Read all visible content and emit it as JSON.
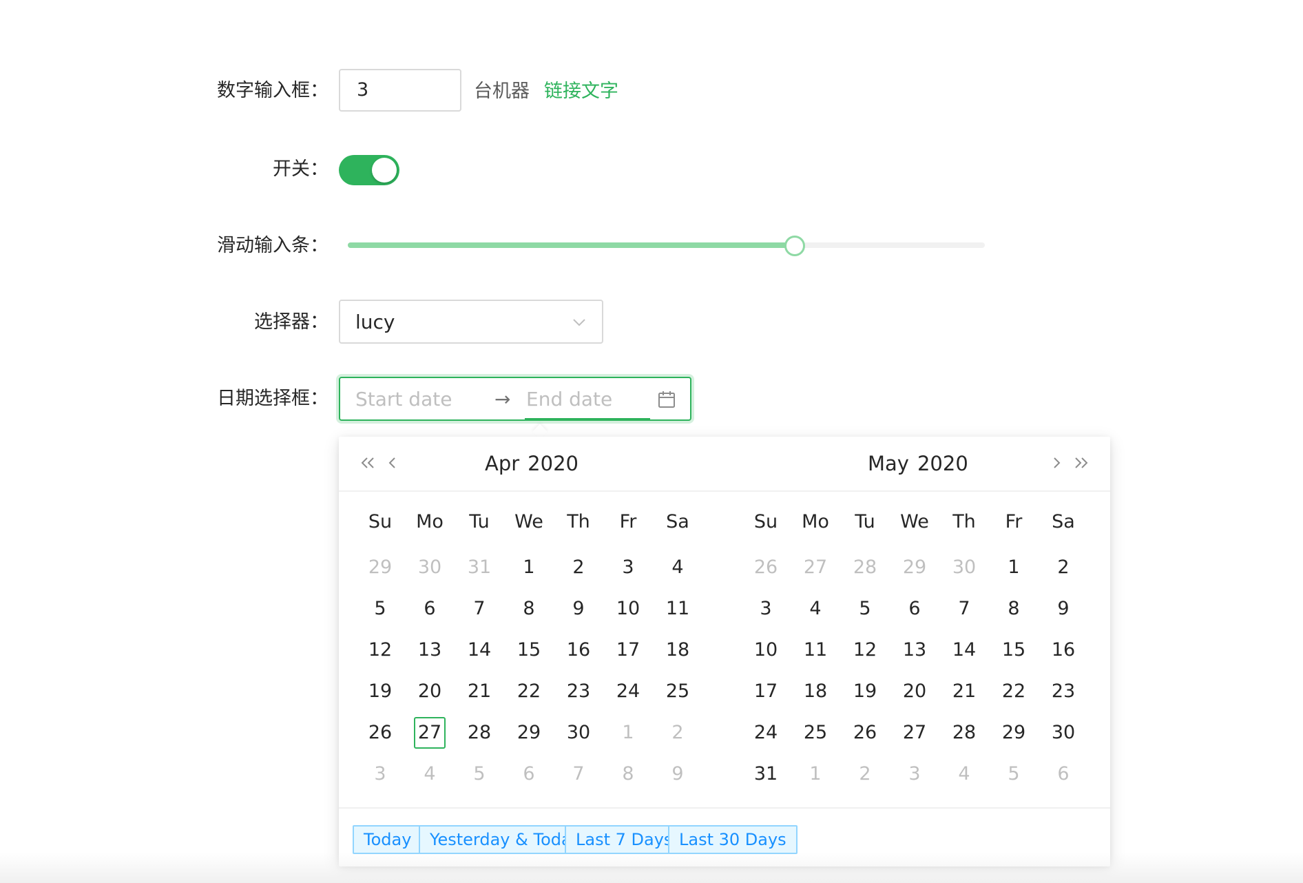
{
  "form": {
    "number_label": "数字输入框：",
    "number_value": "3",
    "number_unit": "台机器",
    "link_text": "链接文字",
    "switch_label": "开关：",
    "switch_on": true,
    "slider_label": "滑动输入条：",
    "slider_value_percent": 70,
    "select_label": "选择器：",
    "select_value": "lucy",
    "date_label": "日期选择框：",
    "date_start_placeholder": "Start date",
    "date_separator": "→",
    "date_end_placeholder": "End date"
  },
  "colors": {
    "primary": "#2eb35c",
    "slider_track": "#8ed9a4",
    "preset_text": "#1890ff",
    "preset_bg": "#e6f7ff",
    "preset_border": "#91d5ff"
  },
  "calendar": {
    "weekdays": [
      "Su",
      "Mo",
      "Tu",
      "We",
      "Th",
      "Fr",
      "Sa"
    ],
    "left": {
      "month": "Apr",
      "year": "2020",
      "weeks": [
        [
          {
            "d": "29",
            "out": true
          },
          {
            "d": "30",
            "out": true
          },
          {
            "d": "31",
            "out": true
          },
          {
            "d": "1"
          },
          {
            "d": "2"
          },
          {
            "d": "3"
          },
          {
            "d": "4"
          }
        ],
        [
          {
            "d": "5"
          },
          {
            "d": "6"
          },
          {
            "d": "7"
          },
          {
            "d": "8"
          },
          {
            "d": "9"
          },
          {
            "d": "10"
          },
          {
            "d": "11"
          }
        ],
        [
          {
            "d": "12"
          },
          {
            "d": "13"
          },
          {
            "d": "14"
          },
          {
            "d": "15"
          },
          {
            "d": "16"
          },
          {
            "d": "17"
          },
          {
            "d": "18"
          }
        ],
        [
          {
            "d": "19"
          },
          {
            "d": "20"
          },
          {
            "d": "21"
          },
          {
            "d": "22"
          },
          {
            "d": "23"
          },
          {
            "d": "24"
          },
          {
            "d": "25"
          }
        ],
        [
          {
            "d": "26"
          },
          {
            "d": "27",
            "today": true
          },
          {
            "d": "28"
          },
          {
            "d": "29"
          },
          {
            "d": "30"
          },
          {
            "d": "1",
            "out": true
          },
          {
            "d": "2",
            "out": true
          }
        ],
        [
          {
            "d": "3",
            "out": true
          },
          {
            "d": "4",
            "out": true
          },
          {
            "d": "5",
            "out": true
          },
          {
            "d": "6",
            "out": true
          },
          {
            "d": "7",
            "out": true
          },
          {
            "d": "8",
            "out": true
          },
          {
            "d": "9",
            "out": true
          }
        ]
      ]
    },
    "right": {
      "month": "May",
      "year": "2020",
      "weeks": [
        [
          {
            "d": "26",
            "out": true
          },
          {
            "d": "27",
            "out": true
          },
          {
            "d": "28",
            "out": true
          },
          {
            "d": "29",
            "out": true
          },
          {
            "d": "30",
            "out": true
          },
          {
            "d": "1"
          },
          {
            "d": "2"
          }
        ],
        [
          {
            "d": "3"
          },
          {
            "d": "4"
          },
          {
            "d": "5"
          },
          {
            "d": "6"
          },
          {
            "d": "7"
          },
          {
            "d": "8"
          },
          {
            "d": "9"
          }
        ],
        [
          {
            "d": "10"
          },
          {
            "d": "11"
          },
          {
            "d": "12"
          },
          {
            "d": "13"
          },
          {
            "d": "14"
          },
          {
            "d": "15"
          },
          {
            "d": "16"
          }
        ],
        [
          {
            "d": "17"
          },
          {
            "d": "18"
          },
          {
            "d": "19"
          },
          {
            "d": "20"
          },
          {
            "d": "21"
          },
          {
            "d": "22"
          },
          {
            "d": "23"
          }
        ],
        [
          {
            "d": "24"
          },
          {
            "d": "25"
          },
          {
            "d": "26"
          },
          {
            "d": "27"
          },
          {
            "d": "28"
          },
          {
            "d": "29"
          },
          {
            "d": "30"
          }
        ],
        [
          {
            "d": "31"
          },
          {
            "d": "1",
            "out": true
          },
          {
            "d": "2",
            "out": true
          },
          {
            "d": "3",
            "out": true
          },
          {
            "d": "4",
            "out": true
          },
          {
            "d": "5",
            "out": true
          },
          {
            "d": "6",
            "out": true
          }
        ]
      ]
    },
    "presets": [
      "Today",
      "Yesterday & Today",
      "Last 7 Days",
      "Last 30 Days"
    ]
  }
}
